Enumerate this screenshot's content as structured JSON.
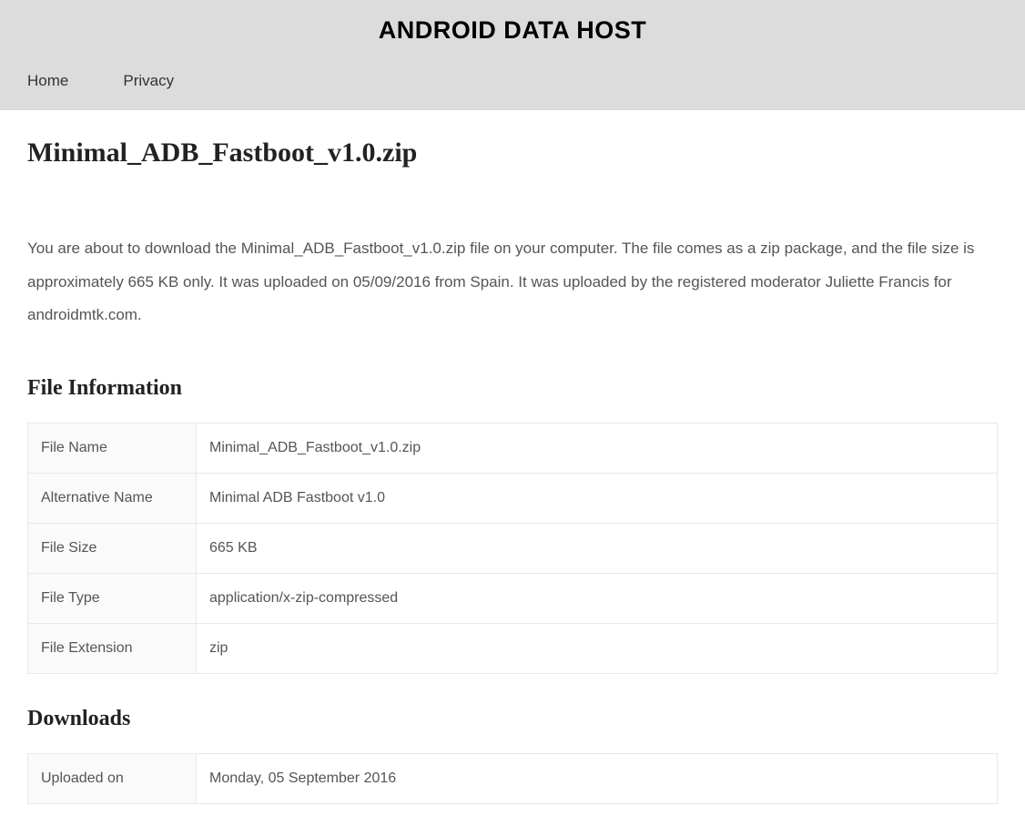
{
  "header": {
    "siteTitle": "ANDROID DATA HOST",
    "nav": {
      "home": "Home",
      "privacy": "Privacy"
    }
  },
  "page": {
    "title": "Minimal_ADB_Fastboot_v1.0.zip",
    "description": "You are about to download the Minimal_ADB_Fastboot_v1.0.zip file on your computer. The file comes as a zip package, and the file size is approximately 665 KB only. It was uploaded on 05/09/2016 from Spain. It was uploaded by the registered moderator Juliette Francis for androidmtk.com."
  },
  "sections": {
    "fileInfoTitle": "File Information",
    "downloadsTitle": "Downloads"
  },
  "fileInfo": {
    "fileNameLabel": "File Name",
    "fileNameValue": "Minimal_ADB_Fastboot_v1.0.zip",
    "altNameLabel": "Alternative Name",
    "altNameValue": "Minimal ADB Fastboot v1.0",
    "fileSizeLabel": "File Size",
    "fileSizeValue": "665 KB",
    "fileTypeLabel": "File Type",
    "fileTypeValue": "application/x-zip-compressed",
    "fileExtLabel": "File Extension",
    "fileExtValue": "zip"
  },
  "downloads": {
    "uploadedOnLabel": "Uploaded on",
    "uploadedOnValue": "Monday, 05 September 2016"
  }
}
